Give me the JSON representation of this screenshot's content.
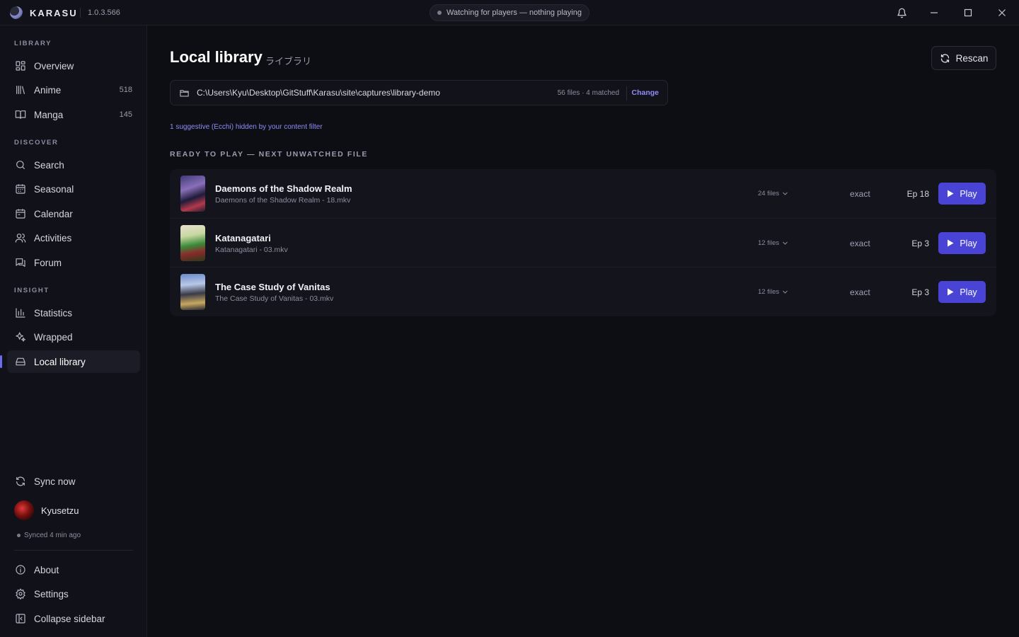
{
  "titlebar": {
    "brand": "KARASU",
    "version": "1.0.3.566",
    "status": "Watching for players — nothing playing"
  },
  "sidebar": {
    "sections": {
      "library": "LIBRARY",
      "discover": "DISCOVER",
      "insight": "INSIGHT"
    },
    "items": {
      "overview": "Overview",
      "anime": "Anime",
      "anime_count": "518",
      "manga": "Manga",
      "manga_count": "145",
      "search": "Search",
      "seasonal": "Seasonal",
      "calendar": "Calendar",
      "activities": "Activities",
      "forum": "Forum",
      "statistics": "Statistics",
      "wrapped": "Wrapped",
      "local_library": "Local library"
    },
    "sync_now": "Sync now",
    "user": "Kyusetzu",
    "synced": "Synced 4 min ago",
    "about": "About",
    "settings": "Settings",
    "collapse": "Collapse sidebar"
  },
  "main": {
    "title": "Local library",
    "subtitle": "ライブラリ",
    "rescan": "Rescan",
    "path": "C:\\Users\\Kyu\\Desktop\\GitStuff\\Karasu\\site\\captures\\library-demo",
    "path_meta": "56 files · 4 matched",
    "change": "Change",
    "filter_note": "1 suggestive (Ecchi) hidden by your content filter",
    "ready_label": "READY TO PLAY — NEXT UNWATCHED FILE",
    "rows": [
      {
        "title": "Daemons of the Shadow Realm",
        "file": "Daemons of the Shadow Realm - 18.mkv",
        "files": "24 files",
        "match": "exact",
        "ep": "Ep 18",
        "play": "Play"
      },
      {
        "title": "Katanagatari",
        "file": "Katanagatari - 03.mkv",
        "files": "12 files",
        "match": "exact",
        "ep": "Ep 3",
        "play": "Play"
      },
      {
        "title": "The Case Study of Vanitas",
        "file": "The Case Study of Vanitas - 03.mkv",
        "files": "12 files",
        "match": "exact",
        "ep": "Ep 3",
        "play": "Play"
      }
    ]
  },
  "colors": {
    "accent": "#4a44d6",
    "accent_text": "#8f8cf5",
    "background": "#0d0e14",
    "sidebar": "#111219"
  }
}
